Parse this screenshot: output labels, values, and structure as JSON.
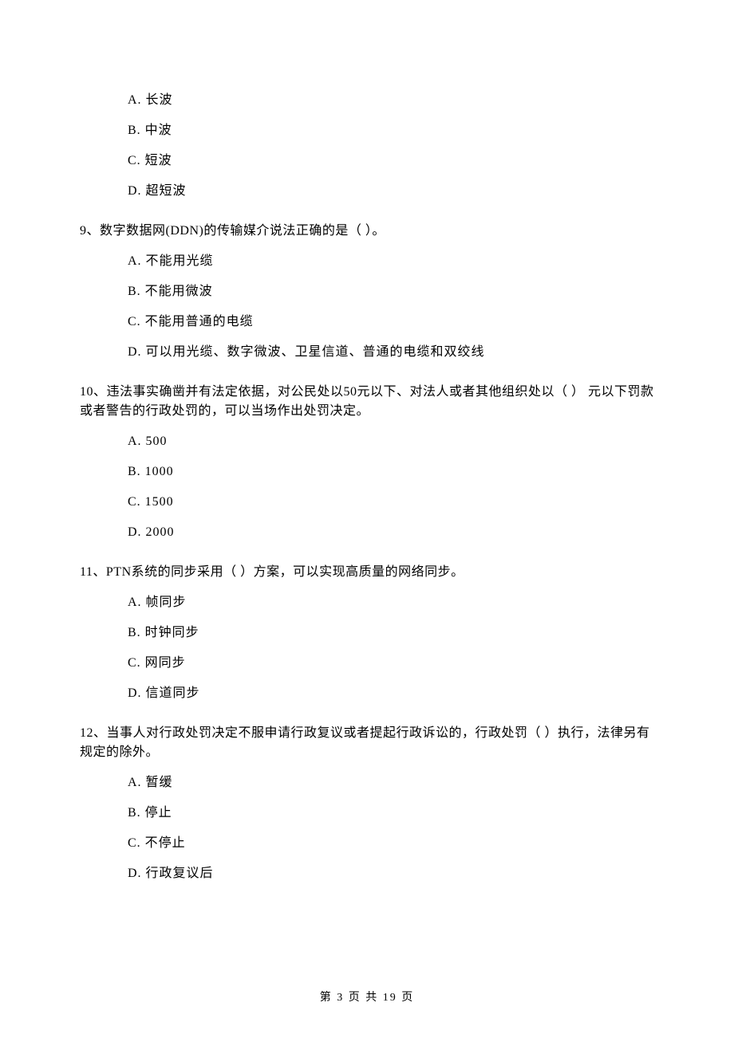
{
  "q8": {
    "a": "A.  长波",
    "b": "B.  中波",
    "c": "C.  短波",
    "d": "D.  超短波"
  },
  "q9": {
    "stem": "9、数字数据网(DDN)的传输媒介说法正确的是（        ）。",
    "a": "A.  不能用光缆",
    "b": "B.  不能用微波",
    "c": "C.  不能用普通的电缆",
    "d": "D.  可以用光缆、数字微波、卫星信道、普通的电缆和双绞线"
  },
  "q10": {
    "stem": "10、违法事实确凿并有法定依据，对公民处以50元以下、对法人或者其他组织处以（        ） 元以下罚款或者警告的行政处罚的，可以当场作出处罚决定。",
    "a": "A.  500",
    "b": "B.  1000",
    "c": "C.  1500",
    "d": "D.  2000"
  },
  "q11": {
    "stem": "11、PTN系统的同步采用（        ）方案，可以实现高质量的网络同步。",
    "a": "A. 帧同步",
    "b": "B. 时钟同步",
    "c": "C. 网同步",
    "d": "D. 信道同步"
  },
  "q12": {
    "stem": "12、当事人对行政处罚决定不服申请行政复议或者提起行政诉讼的，行政处罚（        ）执行，法律另有规定的除外。",
    "a": "A.  暂缓",
    "b": "B.  停止",
    "c": "C.  不停止",
    "d": "D.  行政复议后"
  },
  "footer": "第  3  页  共  19  页"
}
